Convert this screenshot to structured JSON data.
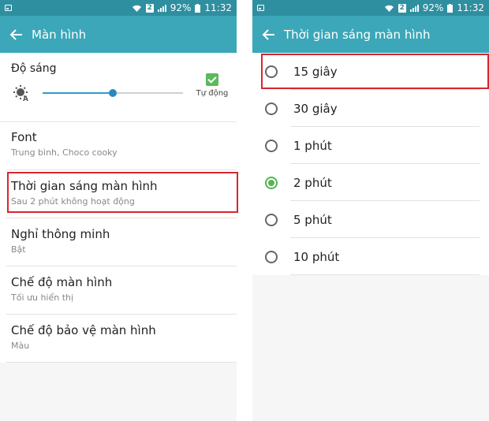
{
  "status_bar": {
    "sim_badge": "2",
    "battery": "92%",
    "time": "11:32"
  },
  "left_screen": {
    "title": "Màn hình",
    "brightness": {
      "label": "Độ sáng",
      "level_percent": 50,
      "auto_label": "Tự động",
      "auto_checked": true
    },
    "items": [
      {
        "title": "Font",
        "subtitle": "Trung bình, Choco cooky"
      },
      {
        "title": "Thời gian sáng màn hình",
        "subtitle": "Sau 2 phút không hoạt động"
      },
      {
        "title": "Nghỉ thông minh",
        "subtitle": "Bật"
      },
      {
        "title": "Chế độ màn hình",
        "subtitle": "Tối ưu hiển thị"
      },
      {
        "title": "Chế độ bảo vệ màn hình",
        "subtitle": "Màu"
      }
    ]
  },
  "right_screen": {
    "title": "Thời gian sáng màn hình",
    "options": [
      {
        "label": "15 giây",
        "selected": false
      },
      {
        "label": "30 giây",
        "selected": false
      },
      {
        "label": "1 phút",
        "selected": false
      },
      {
        "label": "2 phút",
        "selected": true
      },
      {
        "label": "5 phút",
        "selected": false
      },
      {
        "label": "10 phút",
        "selected": false
      }
    ]
  },
  "colors": {
    "status_bar": "#2e8fa0",
    "app_bar": "#3ba7b8",
    "highlight": "#d8262c",
    "radio_selected": "#53b553",
    "slider_fill": "#3399cc"
  },
  "icons": [
    "wifi-icon",
    "signal-icon",
    "back-arrow-icon",
    "auto-brightness-icon",
    "check-icon"
  ]
}
